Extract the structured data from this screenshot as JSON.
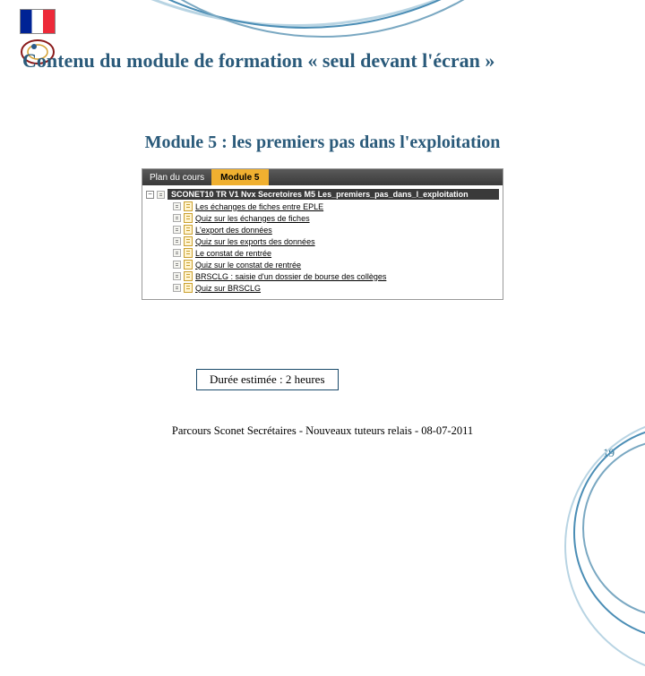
{
  "title": "Contenu du module de formation « seul devant l'écran »",
  "subtitle": "Module 5 : les premiers pas dans l'exploitation",
  "panel": {
    "plan_label": "Plan du cours",
    "module_label": "Module 5",
    "root": "SCONET10 TR V1 Nvx Secretoires M5 Les_premiers_pas_dans_l_exploitation",
    "items": [
      "Les échanges de fiches entre EPLE",
      "Quiz sur les échanges de fiches",
      "L'export des données",
      "Quiz sur les exports des données",
      "Le constat de rentrée",
      "Quiz sur le constat de rentrée",
      "BRSCLG : saisie d'un dossier de bourse des collèges",
      "Quiz sur BRSCLG"
    ]
  },
  "duration": "Durée estimée : 2 heures",
  "footer": "Parcours Sconet Secrétaires - Nouveaux tuteurs relais - 08-07-2011",
  "page": "19",
  "logo_fr_text": ""
}
